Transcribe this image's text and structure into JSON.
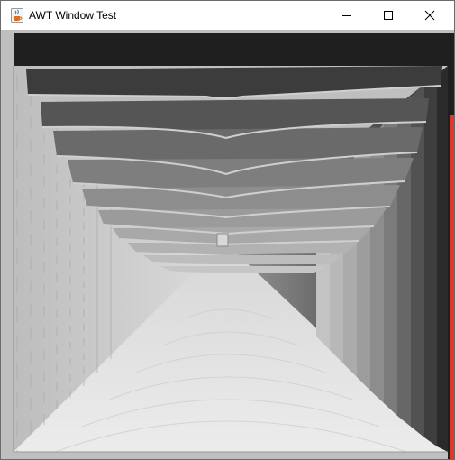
{
  "window": {
    "title": "AWT Window Test",
    "app_icon": "java-coffee-cup-icon",
    "controls": {
      "minimize_icon": "minimize-icon",
      "maximize_icon": "maximize-icon",
      "close_icon": "close-icon"
    }
  },
  "canvas": {
    "description_icon": "rendered-3d-tunnel-graphic",
    "colors": {
      "top_band": "#1f1f1f",
      "light_floor": "#e6e6e6",
      "left_wall": "#c4c4c4",
      "right_wall": "#3a3a3a",
      "red_edge": "#d93a2b"
    }
  }
}
